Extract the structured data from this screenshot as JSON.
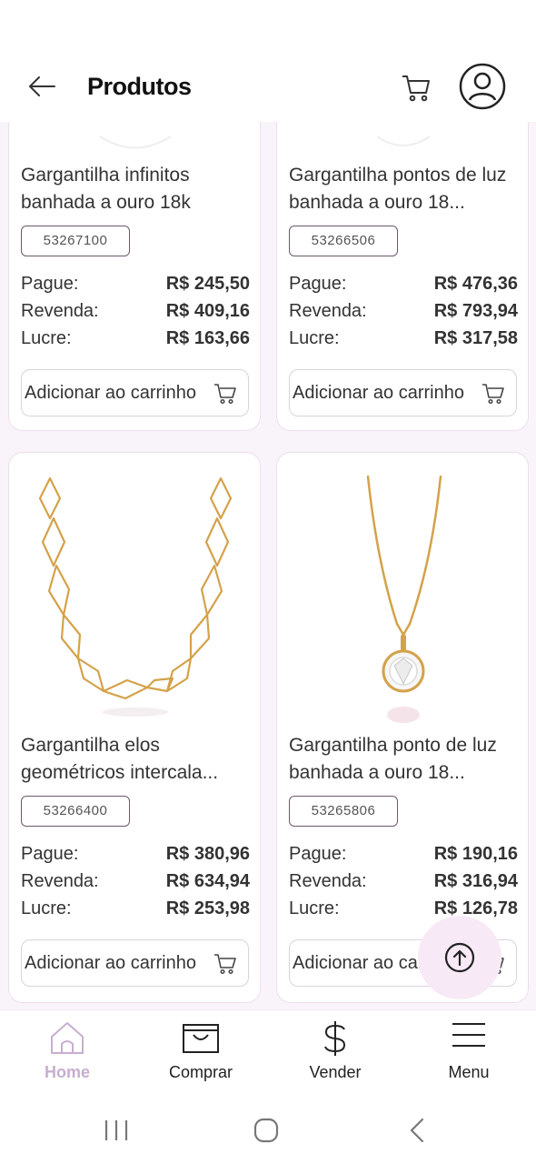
{
  "header": {
    "title": "Produtos",
    "back_icon": "arrow-left-icon",
    "cart_icon": "cart-icon",
    "profile_icon": "user-avatar-icon"
  },
  "labels": {
    "pay": "Pague:",
    "resale": "Revenda:",
    "profit": "Lucre:",
    "add_to_cart": "Adicionar ao carrinho"
  },
  "products": [
    {
      "name": "Gargantilha infinitos banhada a ouro 18k",
      "sku": "53267100",
      "pay": "R$ 245,50",
      "resale": "R$ 409,16",
      "profit": "R$ 163,66"
    },
    {
      "name": "Gargantilha pontos de luz banhada a ouro 18...",
      "sku": "53266506",
      "pay": "R$ 476,36",
      "resale": "R$ 793,94",
      "profit": "R$ 317,58"
    },
    {
      "name": "Gargantilha elos geométricos intercala...",
      "sku": "53266400",
      "pay": "R$ 380,96",
      "resale": "R$ 634,94",
      "profit": "R$ 253,98"
    },
    {
      "name": "Gargantilha ponto de luz banhada a ouro 18...",
      "sku": "53265806",
      "pay": "R$ 190,16",
      "resale": "R$ 316,94",
      "profit": "R$ 126,78"
    }
  ],
  "scroll_top_icon": "arrow-up-circle-icon",
  "bottom_nav": [
    {
      "label": "Home",
      "icon": "home-icon",
      "active": true
    },
    {
      "label": "Comprar",
      "icon": "shopping-bag-icon",
      "active": false
    },
    {
      "label": "Vender",
      "icon": "dollar-icon",
      "active": false
    },
    {
      "label": "Menu",
      "icon": "hamburger-menu-icon",
      "active": false
    }
  ],
  "colors": {
    "accent": "#c7aed0",
    "background": "#f9f4f9",
    "gold": "#d4a24a",
    "fab": "#f7eaf6"
  }
}
